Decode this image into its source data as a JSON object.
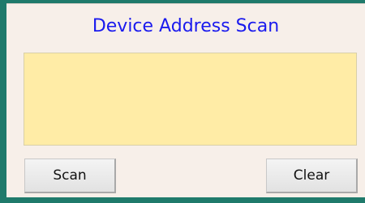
{
  "panel": {
    "title": "Device Address Scan",
    "results_text": "",
    "colors": {
      "frame": "#1f7a6b",
      "panel_bg": "#f7efe9",
      "title": "#1a1aee",
      "results_bg": "#ffeca6"
    }
  },
  "buttons": {
    "scan_label": "Scan",
    "clear_label": "Clear"
  }
}
